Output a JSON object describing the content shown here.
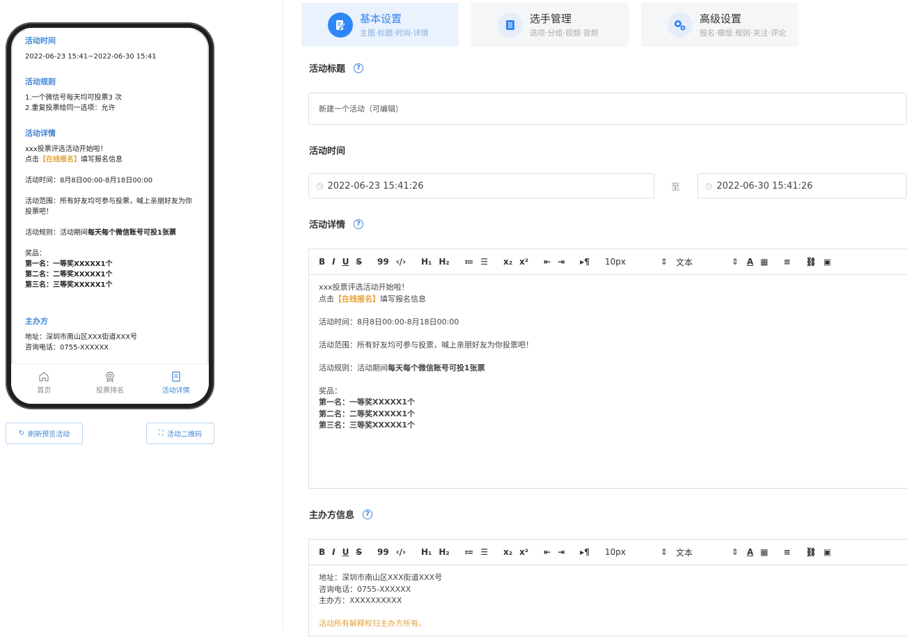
{
  "preview": {
    "time_title": "活动时间",
    "time_value": "2022-06-23 15:41~2022-06-30 15:41",
    "rules_title": "活动规则",
    "rules": [
      "1.一个微信号每天均可投票3 次",
      "2.重复投票给同一选项：允许"
    ],
    "detail_title": "活动详情",
    "detail_line1": "xxx投票评选活动开始啦！",
    "detail_click_prefix": "点击",
    "detail_click_link": "【在线报名】",
    "detail_click_suffix": "填写报名信息",
    "detail_time": "活动时间：8月8日00:00-8月18日00:00",
    "detail_scope": "活动范围：所有好友均可参与投票，喊上亲朋好友为你投票吧！",
    "detail_rule_prefix": "活动规则：活动期间",
    "detail_rule_bold": "每天每个微信账号可投1张票",
    "prize_title": "奖品：",
    "prizes": [
      "第一名：一等奖XXXXX1个",
      "第二名：二等奖XXXXX1个",
      "第三名：三等奖XXXXX1个"
    ],
    "host_title": "主办方",
    "host_address": "地址：深圳市南山区XXX街道XXX号",
    "host_phone": "咨询电话：0755-XXXXXX"
  },
  "tabbar": [
    {
      "label": "首页",
      "icon": "home-icon"
    },
    {
      "label": "投票排名",
      "icon": "ranking-icon"
    },
    {
      "label": "活动详情",
      "icon": "detail-icon"
    }
  ],
  "buttons": {
    "refresh": "刷新预览活动",
    "qrcode": "活动二维码"
  },
  "steps": [
    {
      "title": "基本设置",
      "subtitle": "主图·标题·时间·详情",
      "icon": "edit-icon"
    },
    {
      "title": "选手管理",
      "subtitle": "选项·分组·视频·音频",
      "icon": "list-icon"
    },
    {
      "title": "高级设置",
      "subtitle": "报名·模版·规则·关注·评论",
      "icon": "gears-icon"
    }
  ],
  "form": {
    "title_label": "活动标题",
    "title_value": "新建一个活动（可编辑）",
    "time_label": "活动时间",
    "start_time": "2022-06-23 15:41:26",
    "to": "至",
    "end_time": "2022-06-30 15:41:26",
    "detail_label": "活动详情",
    "host_label": "主办方信息"
  },
  "toolbar": {
    "bold": "B",
    "italic": "I",
    "underline": "U",
    "strike": "S",
    "quote": "99",
    "code": "‹/›",
    "h1": "H₁",
    "h2": "H₂",
    "ol": "≔",
    "ul": "☰",
    "sub": "x₂",
    "sup": "x²",
    "outdent": "⇤",
    "indent": "⇥",
    "direction": "▸¶",
    "size": "10px",
    "font": "文本",
    "color": "A",
    "bg": "▦",
    "align": "≡",
    "link": "⛓",
    "image": "▣"
  },
  "detail_editor": {
    "line1": "xxx投票评选活动开始啦！",
    "click_prefix": "点击",
    "click_link": "【在线报名】",
    "click_suffix": "填写报名信息",
    "time": "活动时间：8月8日00:00-8月18日00:00",
    "scope": "活动范围：所有好友均可参与投票，喊上亲朋好友为你投票吧！",
    "rule_prefix": "活动规则：活动期间",
    "rule_bold": "每天每个微信账号可投1张票",
    "prize_title": "奖品：",
    "prizes": [
      "第一名：一等奖XXXXX1个",
      "第二名：二等奖XXXXX1个",
      "第三名：三等奖XXXXX1个"
    ]
  },
  "host_editor": {
    "address": "地址：深圳市南山区XXX街道XXX号",
    "phone": "咨询电话：0755-XXXXXX",
    "host": "主办方：XXXXXXXXXX",
    "note": "活动所有解释权归主办方所有。"
  },
  "colors": {
    "accent": "#2f86f6",
    "link": "#3f86d6",
    "highlight": "#e2a23a"
  }
}
